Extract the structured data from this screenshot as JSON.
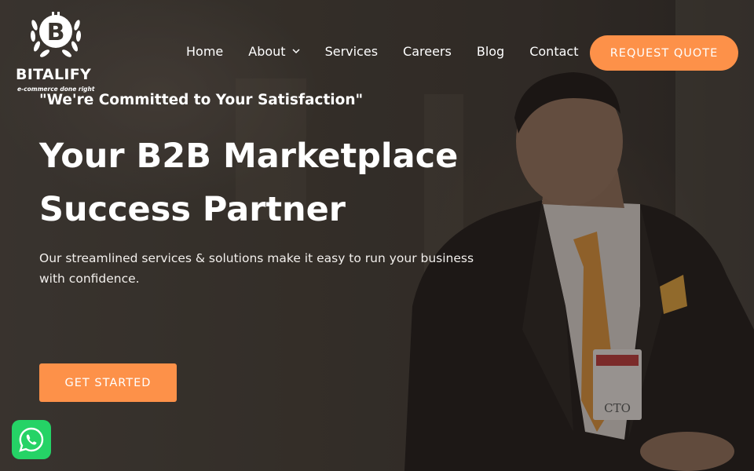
{
  "brand": {
    "name": "BITALIFY",
    "tagline": "e-commerce done right",
    "colors": {
      "accent": "#fd9149",
      "whatsapp": "#25d366",
      "text": "#ffffff"
    }
  },
  "nav": {
    "items": [
      {
        "label": "Home"
      },
      {
        "label": "About",
        "has_dropdown": true
      },
      {
        "label": "Services"
      },
      {
        "label": "Careers"
      },
      {
        "label": "Blog"
      },
      {
        "label": "Contact"
      }
    ],
    "cta_label": "REQUEST QUOTE"
  },
  "hero": {
    "tagline": "\"We're Committed to Your Satisfaction\"",
    "headline_line1": "Your B2B Marketplace",
    "headline_line2": "Success Partner",
    "subtext": "Our streamlined services & solutions make it easy to run your business with confidence.",
    "cta_label": "GET STARTED"
  },
  "badge_text": "CTO",
  "icons": [
    "bitcoin-logo-icon",
    "laurel-icon",
    "chevron-down-icon",
    "whatsapp-icon"
  ]
}
